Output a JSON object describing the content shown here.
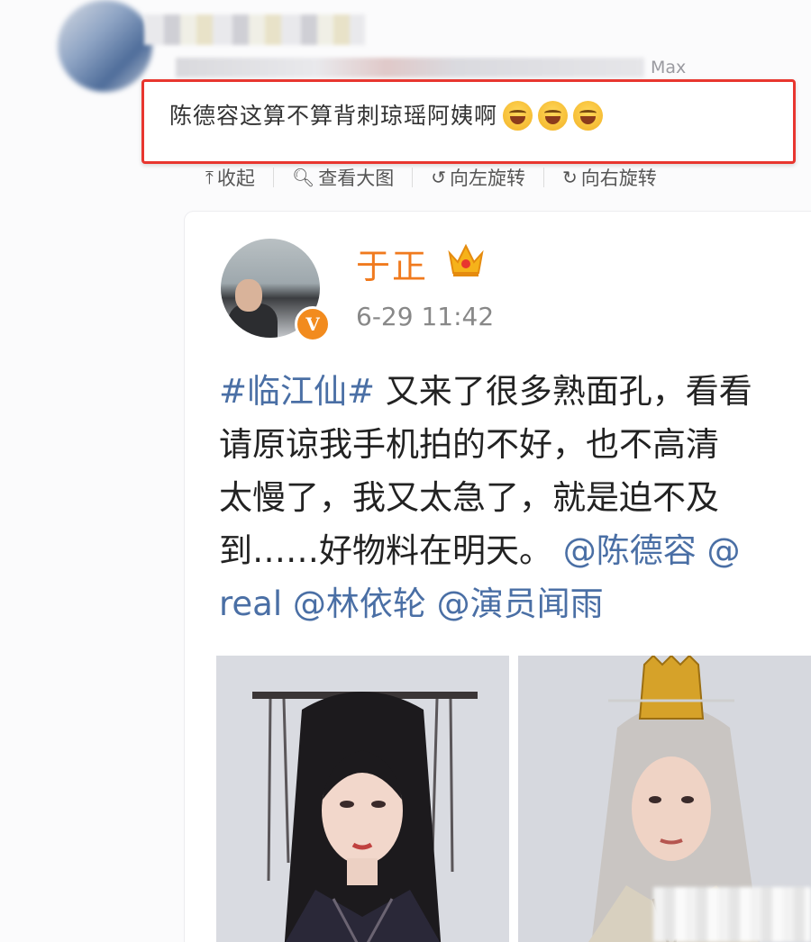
{
  "comment": {
    "device": "Max",
    "text": "陈德容这算不算背刺琼瑶阿姨啊",
    "emoji_count": 3,
    "emoji_icon": "laughing-tears-emoji"
  },
  "toolbar": {
    "collapse_label": "收起",
    "view_large_label": "查看大图",
    "rotate_left_label": "向左旋转",
    "rotate_right_label": "向右旋转"
  },
  "post": {
    "author": "于正",
    "time": "6-29 11:42",
    "verified_badge": "V",
    "lines": [
      {
        "hashtag": "#临江仙#",
        "text": " 又来了很多熟面孔，看看"
      },
      {
        "text": "请原谅我手机拍的不好，也不高清"
      },
      {
        "text": "太慢了，我又太急了，就是迫不及"
      },
      {
        "text": "到……好物料在明天。",
        "mention": " @陈德容 @"
      },
      {
        "mention": "real @林依轮 @演员闻雨"
      }
    ]
  },
  "colors": {
    "highlight_border": "#e8362f",
    "author_color": "#f07a1e",
    "link_color": "#4a6fa5"
  }
}
